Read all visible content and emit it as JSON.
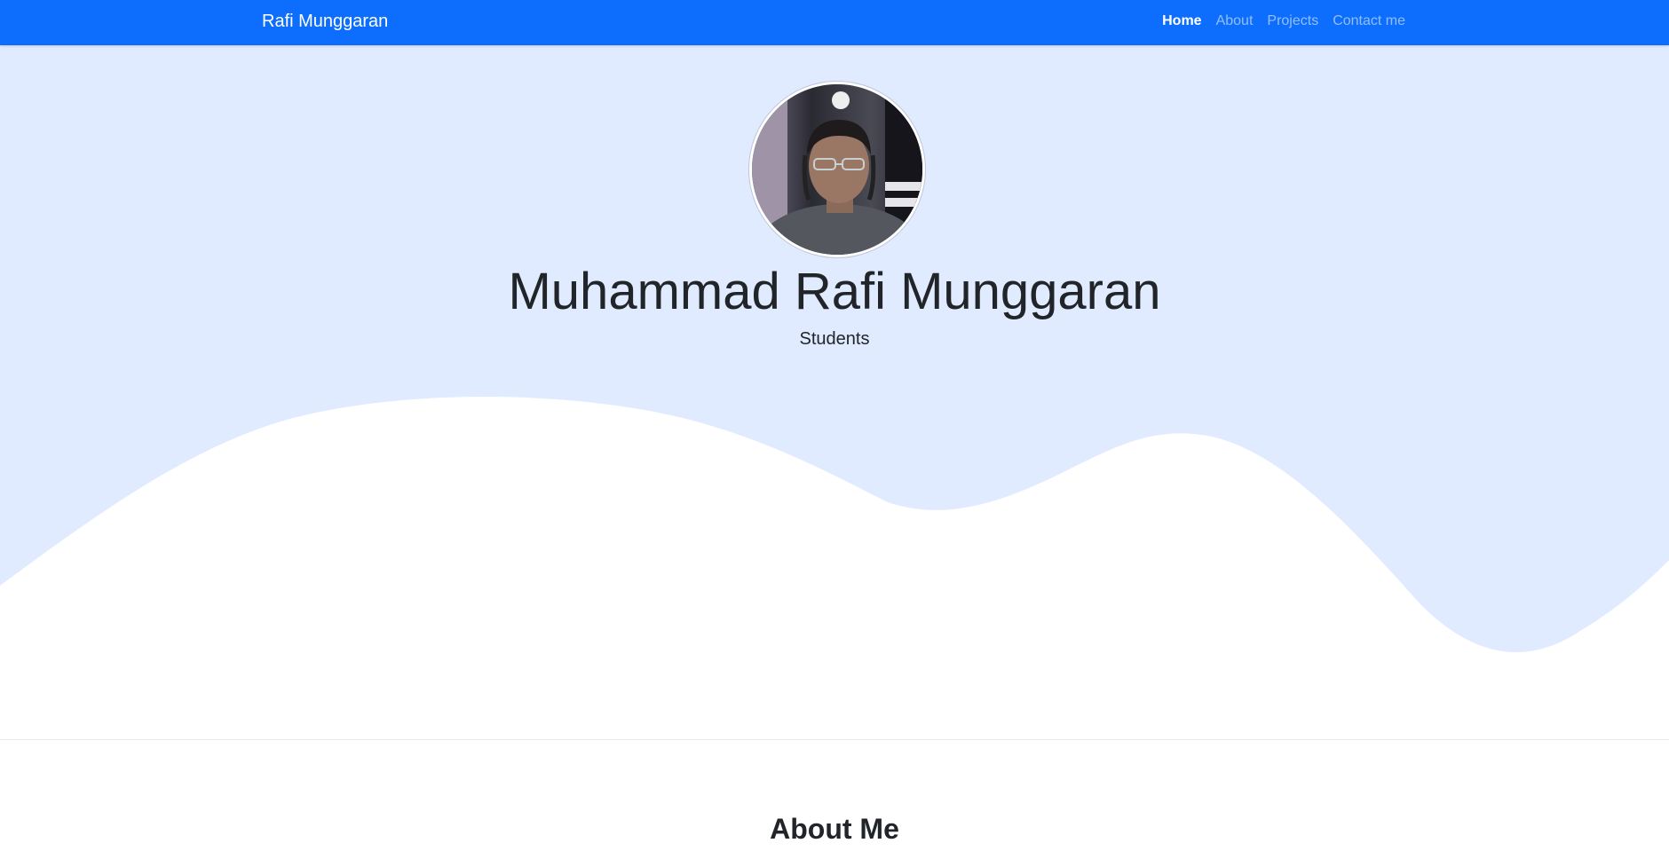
{
  "navbar": {
    "brand": "Rafi Munggaran",
    "links": [
      {
        "label": "Home",
        "active": true
      },
      {
        "label": "About",
        "active": false
      },
      {
        "label": "Projects",
        "active": false
      },
      {
        "label": "Contact me",
        "active": false
      }
    ],
    "background_color": "#0d6efd"
  },
  "hero": {
    "name": "Muhammad Rafi Munggaran",
    "subtitle": "Students",
    "background_color": "#e0ebff",
    "avatar_description": "profile-photo"
  },
  "about": {
    "title": "About Me"
  }
}
